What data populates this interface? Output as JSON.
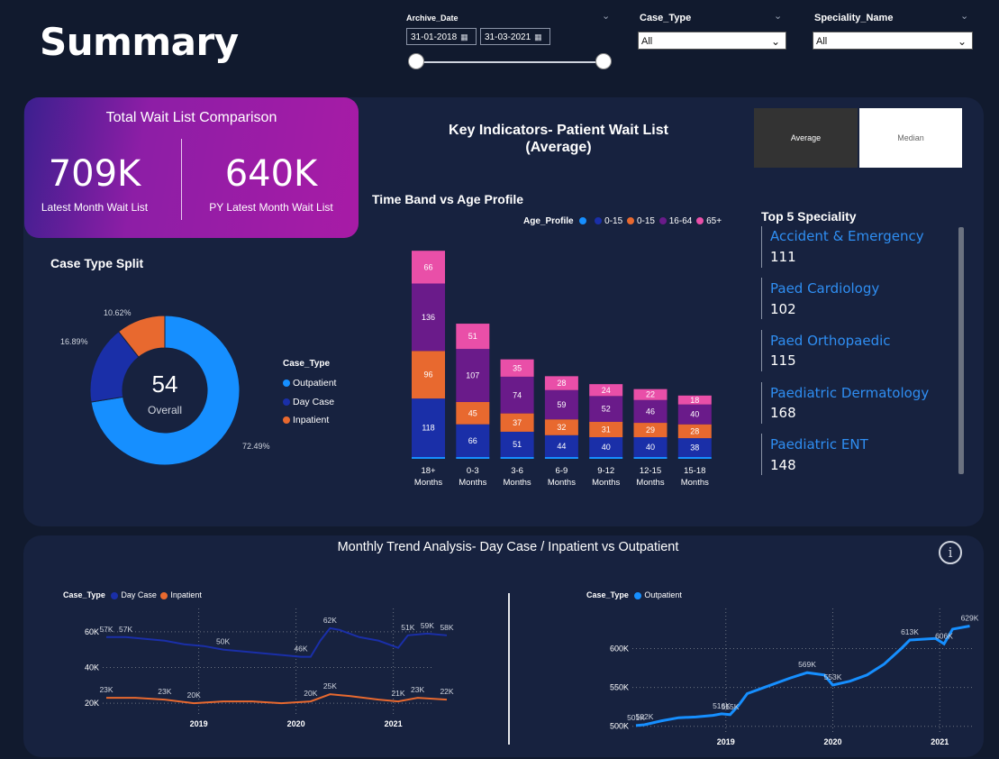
{
  "header": {
    "title": "Summary"
  },
  "filters": {
    "archive_date": {
      "label": "Archive_Date",
      "start": "31-01-2018",
      "end": "31-03-2021"
    },
    "case_type": {
      "label": "Case_Type",
      "value": "All"
    },
    "speciality": {
      "label": "Speciality_Name",
      "value": "All"
    }
  },
  "kpi": {
    "title": "Total Wait List Comparison",
    "latest": {
      "value": "709K",
      "label": "Latest Month Wait List"
    },
    "py": {
      "value": "640K",
      "label": "PY Latest Month Wait List"
    }
  },
  "key_indicators": {
    "title_line1": "Key Indicators- Patient Wait List",
    "title_line2": "(Average)",
    "toggle_average": "Average",
    "toggle_median": "Median"
  },
  "case_split": {
    "title": "Case Type Split",
    "center_value": "54",
    "center_label": "Overall",
    "legend_title": "Case_Type",
    "legend": [
      {
        "name": "Outpatient",
        "color": "#168fff"
      },
      {
        "name": "Day Case",
        "color": "#1a2fa8"
      },
      {
        "name": "Inpatient",
        "color": "#e8692f"
      }
    ],
    "pct_labels": [
      "10.62%",
      "16.89%",
      "72.49%"
    ]
  },
  "time_band": {
    "title": "Time Band vs Age Profile",
    "legend_title": "Age_Profile",
    "legend": [
      {
        "name": "",
        "color": "#168fff"
      },
      {
        "name": "0-15",
        "color": "#1a2fa8"
      },
      {
        "name": "0-15",
        "color": "#e8692f"
      },
      {
        "name": "16-64",
        "color": "#6a1b8a"
      },
      {
        "name": "65+",
        "color": "#e94fa8"
      }
    ]
  },
  "top5": {
    "title": "Top 5 Speciality",
    "items": [
      {
        "name": "Accident & Emergency",
        "value": "111"
      },
      {
        "name": "Paed Cardiology",
        "value": "102"
      },
      {
        "name": "Paed Orthopaedic",
        "value": "115"
      },
      {
        "name": "Paediatric Dermatology",
        "value": "168"
      },
      {
        "name": "Paediatric ENT",
        "value": "148"
      }
    ]
  },
  "trend": {
    "title": "Monthly Trend Analysis- Day Case / Inpatient vs Outpatient",
    "left_legend_title": "Case_Type",
    "left_legend": [
      {
        "name": "Day Case",
        "color": "#1a2fa8"
      },
      {
        "name": "Inpatient",
        "color": "#e8692f"
      }
    ],
    "right_legend_title": "Case_Type",
    "right_legend": [
      {
        "name": "Outpatient",
        "color": "#168fff"
      }
    ]
  },
  "chart_data": [
    {
      "type": "pie",
      "title": "Case Type Split",
      "categories": [
        "Outpatient",
        "Day Case",
        "Inpatient"
      ],
      "values": [
        72.49,
        16.89,
        10.62
      ],
      "colors": [
        "#168fff",
        "#1a2fa8",
        "#e8692f"
      ]
    },
    {
      "type": "bar",
      "title": "Time Band vs Age Profile",
      "stacked": true,
      "categories": [
        "18+ Months",
        "0-3 Months",
        "3-6 Months",
        "6-9 Months",
        "9-12 Months",
        "12-15 Months",
        "15-18 Months"
      ],
      "series": [
        {
          "name": "0-15",
          "color": "#1a2fa8",
          "values": [
            118,
            66,
            51,
            44,
            40,
            40,
            38
          ]
        },
        {
          "name": "0-15",
          "color": "#e8692f",
          "values": [
            96,
            45,
            37,
            32,
            31,
            29,
            28
          ]
        },
        {
          "name": "16-64",
          "color": "#6a1b8a",
          "values": [
            136,
            107,
            74,
            59,
            52,
            46,
            40
          ]
        },
        {
          "name": "65+",
          "color": "#e94fa8",
          "values": [
            66,
            51,
            35,
            28,
            24,
            22,
            18
          ]
        }
      ]
    },
    {
      "type": "line",
      "xticks": [
        "2019",
        "2020",
        "2021"
      ],
      "yticks": [
        "20K",
        "40K",
        "60K"
      ],
      "ylim": [
        15,
        68
      ],
      "series": [
        {
          "name": "Day Case",
          "color": "#1a2fa8",
          "points": [
            [
              0,
              57
            ],
            [
              2,
              57
            ],
            [
              4,
              56
            ],
            [
              6,
              55
            ],
            [
              8,
              53
            ],
            [
              10,
              52
            ],
            [
              12,
              50
            ],
            [
              14,
              49
            ],
            [
              16,
              48
            ],
            [
              18,
              47
            ],
            [
              20,
              46
            ],
            [
              21,
              46
            ],
            [
              22,
              55
            ],
            [
              23,
              62
            ],
            [
              24,
              61
            ],
            [
              26,
              57
            ],
            [
              28,
              55
            ],
            [
              30,
              51
            ],
            [
              31,
              58
            ],
            [
              33,
              59
            ],
            [
              35,
              58
            ]
          ],
          "labels": [
            {
              "i": 0,
              "t": "57K"
            },
            {
              "i": 1,
              "t": "57K"
            },
            {
              "i": 6,
              "t": "50K"
            },
            {
              "i": 10,
              "t": "46K"
            },
            {
              "i": 13,
              "t": "62K"
            },
            {
              "i": 18,
              "t": "51K"
            },
            {
              "i": 19,
              "t": "59K"
            },
            {
              "i": 20,
              "t": "58K"
            }
          ]
        },
        {
          "name": "Inpatient",
          "color": "#e8692f",
          "points": [
            [
              0,
              23
            ],
            [
              3,
              23
            ],
            [
              6,
              22
            ],
            [
              9,
              20
            ],
            [
              12,
              21
            ],
            [
              15,
              21
            ],
            [
              18,
              20
            ],
            [
              21,
              21
            ],
            [
              23,
              25
            ],
            [
              25,
              24
            ],
            [
              28,
              22
            ],
            [
              30,
              21
            ],
            [
              32,
              23
            ],
            [
              35,
              22
            ]
          ],
          "labels": [
            {
              "i": 0,
              "t": "23K"
            },
            {
              "i": 2,
              "t": "23K"
            },
            {
              "i": 3,
              "t": "20K"
            },
            {
              "i": 7,
              "t": "20K"
            },
            {
              "i": 8,
              "t": "25K"
            },
            {
              "i": 11,
              "t": "21K"
            },
            {
              "i": 12,
              "t": "23K"
            },
            {
              "i": 13,
              "t": "22K"
            }
          ]
        }
      ]
    },
    {
      "type": "line",
      "xticks": [
        "2019",
        "2020",
        "2021"
      ],
      "yticks": [
        "500K",
        "550K",
        "600K"
      ],
      "ylim": [
        495,
        640
      ],
      "series": [
        {
          "name": "Outpatient",
          "color": "#168fff",
          "points": [
            [
              0,
              501
            ],
            [
              1,
              502
            ],
            [
              3,
              507
            ],
            [
              5,
              511
            ],
            [
              7,
              512
            ],
            [
              9,
              514
            ],
            [
              10,
              516
            ],
            [
              11,
              515
            ],
            [
              12,
              527
            ],
            [
              13,
              542
            ],
            [
              15,
              550
            ],
            [
              18,
              562
            ],
            [
              20,
              569
            ],
            [
              22,
              566
            ],
            [
              23,
              553
            ],
            [
              25,
              558
            ],
            [
              27,
              566
            ],
            [
              29,
              580
            ],
            [
              31,
              600
            ],
            [
              32,
              611
            ],
            [
              35,
              613
            ],
            [
              36,
              606
            ],
            [
              37,
              625
            ],
            [
              39,
              629
            ]
          ],
          "labels": [
            {
              "i": 0,
              "t": "501K"
            },
            {
              "i": 1,
              "t": "502K"
            },
            {
              "i": 6,
              "t": "516K"
            },
            {
              "i": 7,
              "t": "515K"
            },
            {
              "i": 12,
              "t": "569K"
            },
            {
              "i": 14,
              "t": "553K"
            },
            {
              "i": 19,
              "t": "613K"
            },
            {
              "i": 21,
              "t": "606K"
            },
            {
              "i": 23,
              "t": "629K"
            }
          ]
        }
      ]
    }
  ]
}
